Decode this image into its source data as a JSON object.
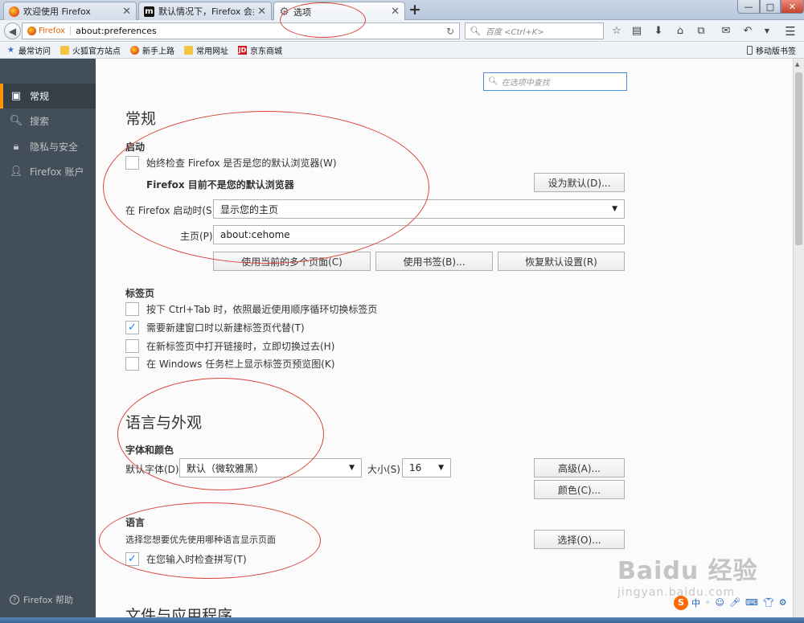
{
  "tabs": [
    {
      "label": "欢迎使用 Firefox",
      "icon": "firefox-icon"
    },
    {
      "label": "默认情况下，Firefox 会共享",
      "icon": "m-site-icon"
    },
    {
      "label": "选项",
      "icon": "gear-icon"
    }
  ],
  "window_controls": {
    "minimize": "—",
    "maximize": "□",
    "close": "✕"
  },
  "navbar": {
    "identity_label": "Firefox",
    "url": "about:preferences",
    "search_placeholder": "百度 <Ctrl+K>"
  },
  "bookmarks": [
    {
      "label": "最常访问",
      "icon": "star-bookmark-icon"
    },
    {
      "label": "火狐官方站点",
      "icon": "folder-icon"
    },
    {
      "label": "新手上路",
      "icon": "firefox-icon"
    },
    {
      "label": "常用网址",
      "icon": "folder-icon"
    },
    {
      "label": "京东商城",
      "icon": "jd-icon",
      "icon_text": "JD"
    }
  ],
  "mobile_bookmarks": "移动版书签",
  "sidebar": {
    "categories": [
      {
        "label": "常规",
        "icon": "general-icon",
        "selected": true
      },
      {
        "label": "搜索",
        "icon": "search-icon",
        "selected": false
      },
      {
        "label": "隐私与安全",
        "icon": "lock-icon",
        "selected": false
      },
      {
        "label": "Firefox 账户",
        "icon": "account-icon",
        "selected": false
      }
    ],
    "help": "Firefox 帮助"
  },
  "find_placeholder": "在选项中查找",
  "general": {
    "title": "常规",
    "startup": {
      "title": "启动",
      "check_default": "始终检查 Firefox 是否是您的默认浏览器(W)",
      "check_default_checked": false,
      "not_default_msg": "Firefox 目前不是您的默认浏览器",
      "set_default_btn": "设为默认(D)...",
      "on_start_label": "在 Firefox 启动时(S)",
      "on_start_value": "显示您的主页",
      "homepage_label": "主页(P)",
      "homepage_value": "about:cehome",
      "use_current_btn": "使用当前的多个页面(C)",
      "use_bookmark_btn": "使用书签(B)...",
      "restore_default_btn": "恢复默认设置(R)"
    },
    "tabs_section": {
      "title": "标签页",
      "options": [
        {
          "label": "按下 Ctrl+Tab 时，依照最近使用顺序循环切换标签页",
          "checked": false
        },
        {
          "label": "需要新建窗口时以新建标签页代替(T)",
          "checked": true
        },
        {
          "label": "在新标签页中打开链接时，立即切换过去(H)",
          "checked": false
        },
        {
          "label": "在 Windows 任务栏上显示标签页预览图(K)",
          "checked": false
        }
      ]
    }
  },
  "language_appearance": {
    "title": "语言与外观",
    "fonts": {
      "title": "字体和颜色",
      "default_font_label": "默认字体(D)",
      "default_font_value": "默认（微软雅黑）",
      "size_label": "大小(S)",
      "size_value": "16",
      "advanced_btn": "高级(A)...",
      "colors_btn": "颜色(C)..."
    },
    "language": {
      "title": "语言",
      "desc": "选择您想要优先使用哪种语言显示页面",
      "choose_btn": "选择(O)...",
      "spellcheck": "在您输入时检查拼写(T)",
      "spellcheck_checked": true
    }
  },
  "next_section_title": "文件与应用程序",
  "watermark": {
    "line1": "Baidu 经验",
    "line2": "jingyan.baidu.com"
  },
  "ime": {
    "logo": "S",
    "mode": "中"
  },
  "colors": {
    "sidebar_bg": "#424f5a",
    "accent": "#ff9500",
    "focus": "#4a90d9",
    "annotation": "#d9443b"
  }
}
